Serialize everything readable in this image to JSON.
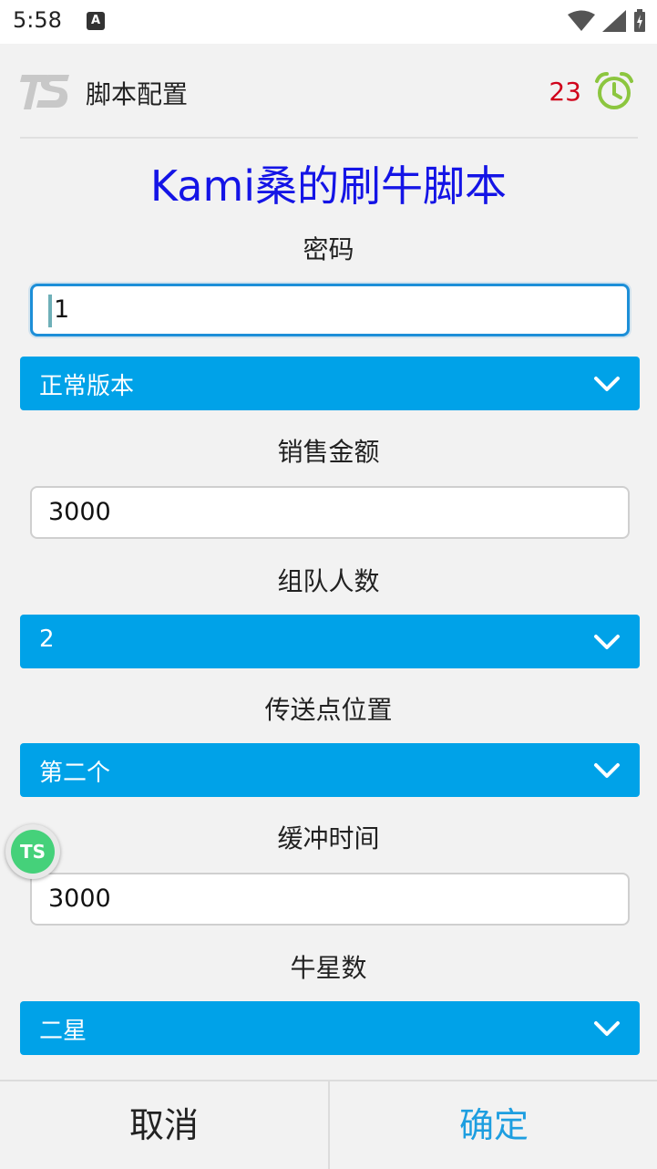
{
  "status_bar": {
    "time": "5:58",
    "notification_icon": "A"
  },
  "header": {
    "title": "脚本配置",
    "countdown": "23",
    "alarm_color": "#8cc63f"
  },
  "script_title": "Kami桑的刷牛脚本",
  "fields": {
    "password": {
      "label": "密码",
      "value": "1"
    },
    "version": {
      "value": "正常版本"
    },
    "sales_amount": {
      "label": "销售金额",
      "value": "3000"
    },
    "team_size": {
      "label": "组队人数",
      "value": "2"
    },
    "teleport": {
      "label": "传送点位置",
      "value": "第二个"
    },
    "buffer_time": {
      "label": "缓冲时间",
      "value": "3000"
    },
    "bull_stars": {
      "label": "牛星数",
      "value": "二星"
    }
  },
  "floating_button": {
    "text": "TS"
  },
  "footer": {
    "cancel": "取消",
    "ok": "确定"
  },
  "colors": {
    "accent": "#00a2e8",
    "title": "#1414e6",
    "count": "#d0021b",
    "ok": "#1d9ee0"
  }
}
